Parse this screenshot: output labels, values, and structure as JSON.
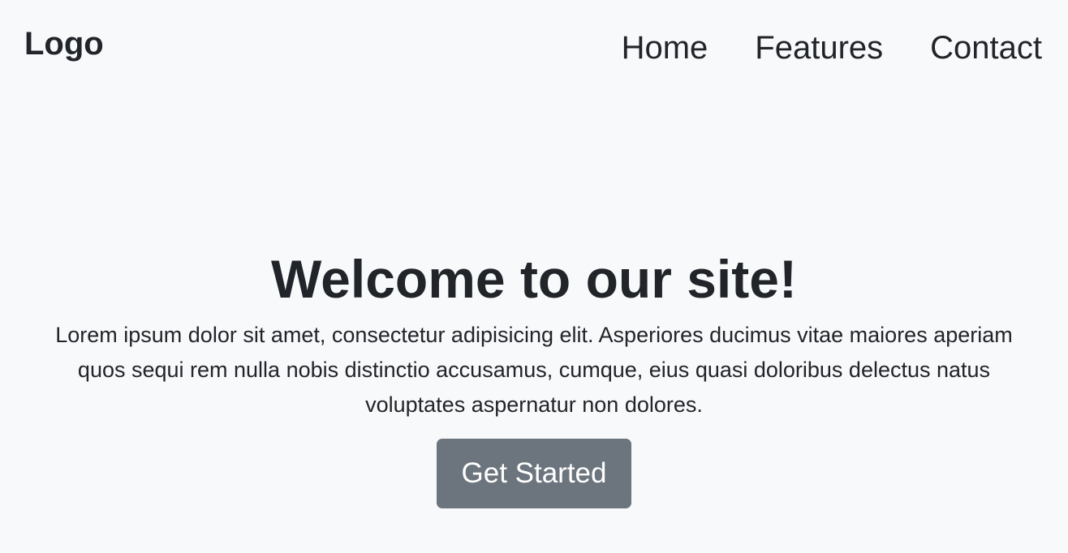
{
  "header": {
    "logo": "Logo",
    "nav": [
      {
        "label": "Home"
      },
      {
        "label": "Features"
      },
      {
        "label": "Contact"
      }
    ]
  },
  "hero": {
    "title": "Welcome to our site!",
    "text": "Lorem ipsum dolor sit amet, consectetur adipisicing elit. Asperiores ducimus vitae maiores aperiam quos sequi rem nulla nobis distinctio accusamus, cumque, eius quasi doloribus delectus natus voluptates aspernatur non dolores.",
    "cta_label": "Get Started"
  },
  "colors": {
    "background": "#f8f9fb",
    "text": "#212529",
    "button": "#6c757d",
    "button_text": "#ffffff"
  }
}
